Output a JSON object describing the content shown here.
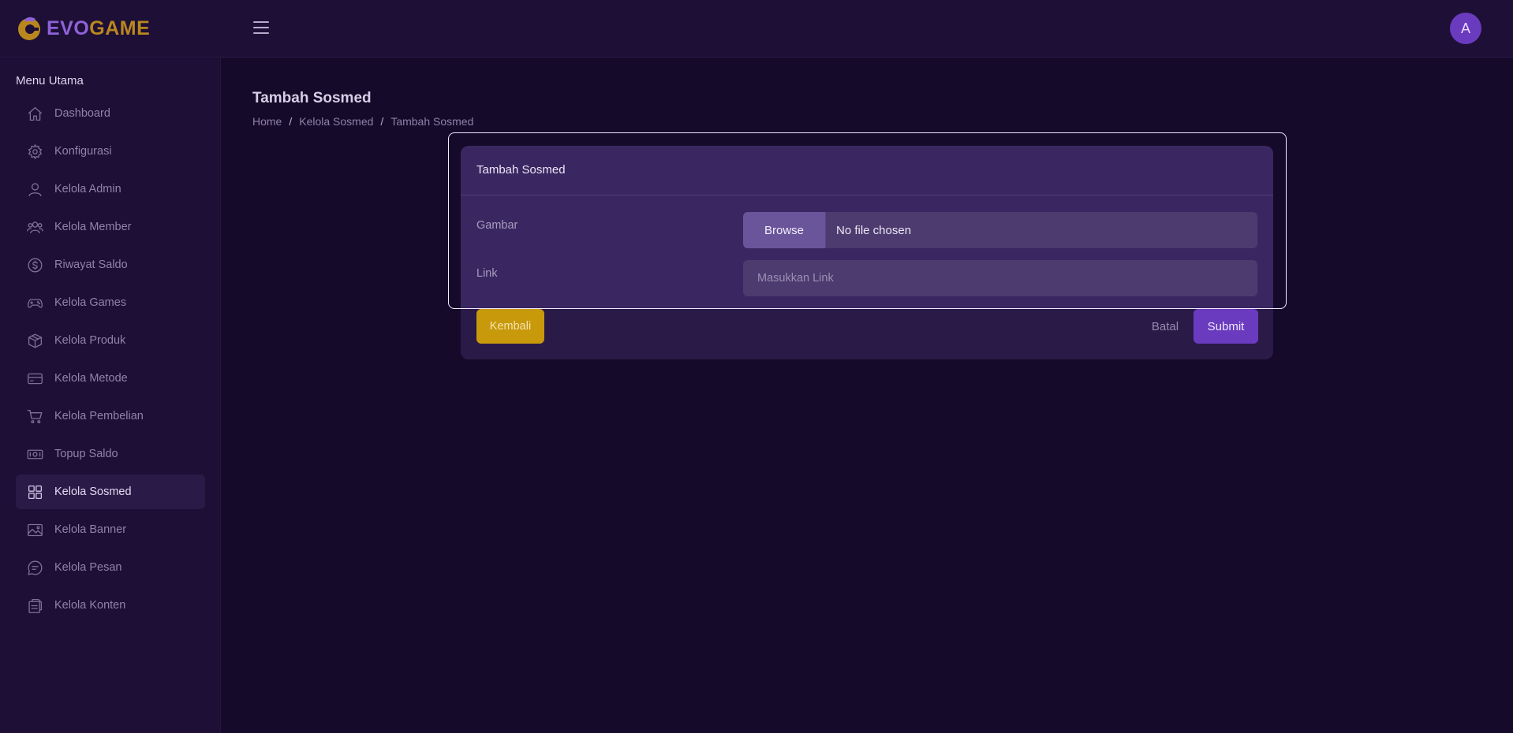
{
  "app": {
    "logo_text_part1": "EVO",
    "logo_text_part2": "GAME",
    "avatar_initial": "A"
  },
  "sidebar": {
    "title": "Menu Utama",
    "items": [
      {
        "label": "Dashboard",
        "icon": "home-icon"
      },
      {
        "label": "Konfigurasi",
        "icon": "gear-icon"
      },
      {
        "label": "Kelola Admin",
        "icon": "user-icon"
      },
      {
        "label": "Kelola Member",
        "icon": "users-icon"
      },
      {
        "label": "Riwayat Saldo",
        "icon": "dollar-circle-icon"
      },
      {
        "label": "Kelola Games",
        "icon": "gamepad-icon"
      },
      {
        "label": "Kelola Produk",
        "icon": "box-icon"
      },
      {
        "label": "Kelola Metode",
        "icon": "credit-card-icon"
      },
      {
        "label": "Kelola Pembelian",
        "icon": "cart-icon"
      },
      {
        "label": "Topup Saldo",
        "icon": "money-icon"
      },
      {
        "label": "Kelola Sosmed",
        "icon": "grid-icon",
        "active": true
      },
      {
        "label": "Kelola Banner",
        "icon": "image-icon"
      },
      {
        "label": "Kelola Pesan",
        "icon": "message-icon"
      },
      {
        "label": "Kelola Konten",
        "icon": "document-icon"
      }
    ]
  },
  "page": {
    "title": "Tambah Sosmed",
    "breadcrumb": [
      "Home",
      "Kelola Sosmed",
      "Tambah Sosmed"
    ]
  },
  "form": {
    "card_title": "Tambah Sosmed",
    "image_label": "Gambar",
    "browse_label": "Browse",
    "file_status": "No file chosen",
    "link_label": "Link",
    "link_placeholder": "Masukkan Link",
    "link_value": ""
  },
  "actions": {
    "back_label": "Kembali",
    "cancel_label": "Batal",
    "submit_label": "Submit"
  },
  "colors": {
    "background": "#160a2b",
    "sidebar": "#1d0f36",
    "accent_purple": "#6a3bbf",
    "accent_gold": "#c8990b"
  }
}
